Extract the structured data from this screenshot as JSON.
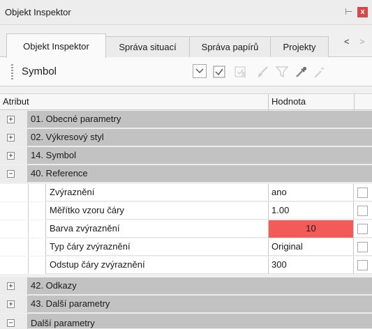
{
  "window": {
    "title": "Objekt Inspektor",
    "pin_glyph": "⊢",
    "close_glyph": "x"
  },
  "tabs": [
    {
      "label": "Objekt Inspektor",
      "active": true
    },
    {
      "label": "Správa situací",
      "active": false
    },
    {
      "label": "Správa papírů",
      "active": false
    },
    {
      "label": "Projekty",
      "active": false
    }
  ],
  "tab_nav": {
    "prev": "<",
    "next": ">"
  },
  "toolbar": {
    "symbol_label": "Symbol",
    "icons": [
      "chevron-down-icon",
      "checkbox-check-icon",
      "select-disabled-icon",
      "brush-icon",
      "filter-icon",
      "pipette-icon",
      "wand-icon"
    ]
  },
  "grid": {
    "col_attribute": "Atribut",
    "col_value": "Hodnota",
    "groups_top": [
      {
        "label": "01. Obecné parametry",
        "expander": "+"
      },
      {
        "label": "02. Výkresový styl",
        "expander": "+"
      },
      {
        "label": "14. Symbol",
        "expander": "+"
      },
      {
        "label": "40. Reference",
        "expander": "−"
      }
    ],
    "properties": [
      {
        "label": "Zvýraznění",
        "value": "ano"
      },
      {
        "label": "Měřítko vzoru čáry",
        "value": "1.00"
      },
      {
        "label": "Barva zvýraznění",
        "value": "10",
        "color": "#f25b57"
      },
      {
        "label": "Typ čáry zvýraznění",
        "value": "Original"
      },
      {
        "label": "Odstup čáry zvýraznění",
        "value": "300"
      }
    ],
    "groups_bottom": [
      {
        "label": "42. Odkazy",
        "expander": "+"
      },
      {
        "label": "43. Další parametry",
        "expander": "+"
      },
      {
        "label": "Další parametry",
        "expander": "−"
      }
    ]
  }
}
